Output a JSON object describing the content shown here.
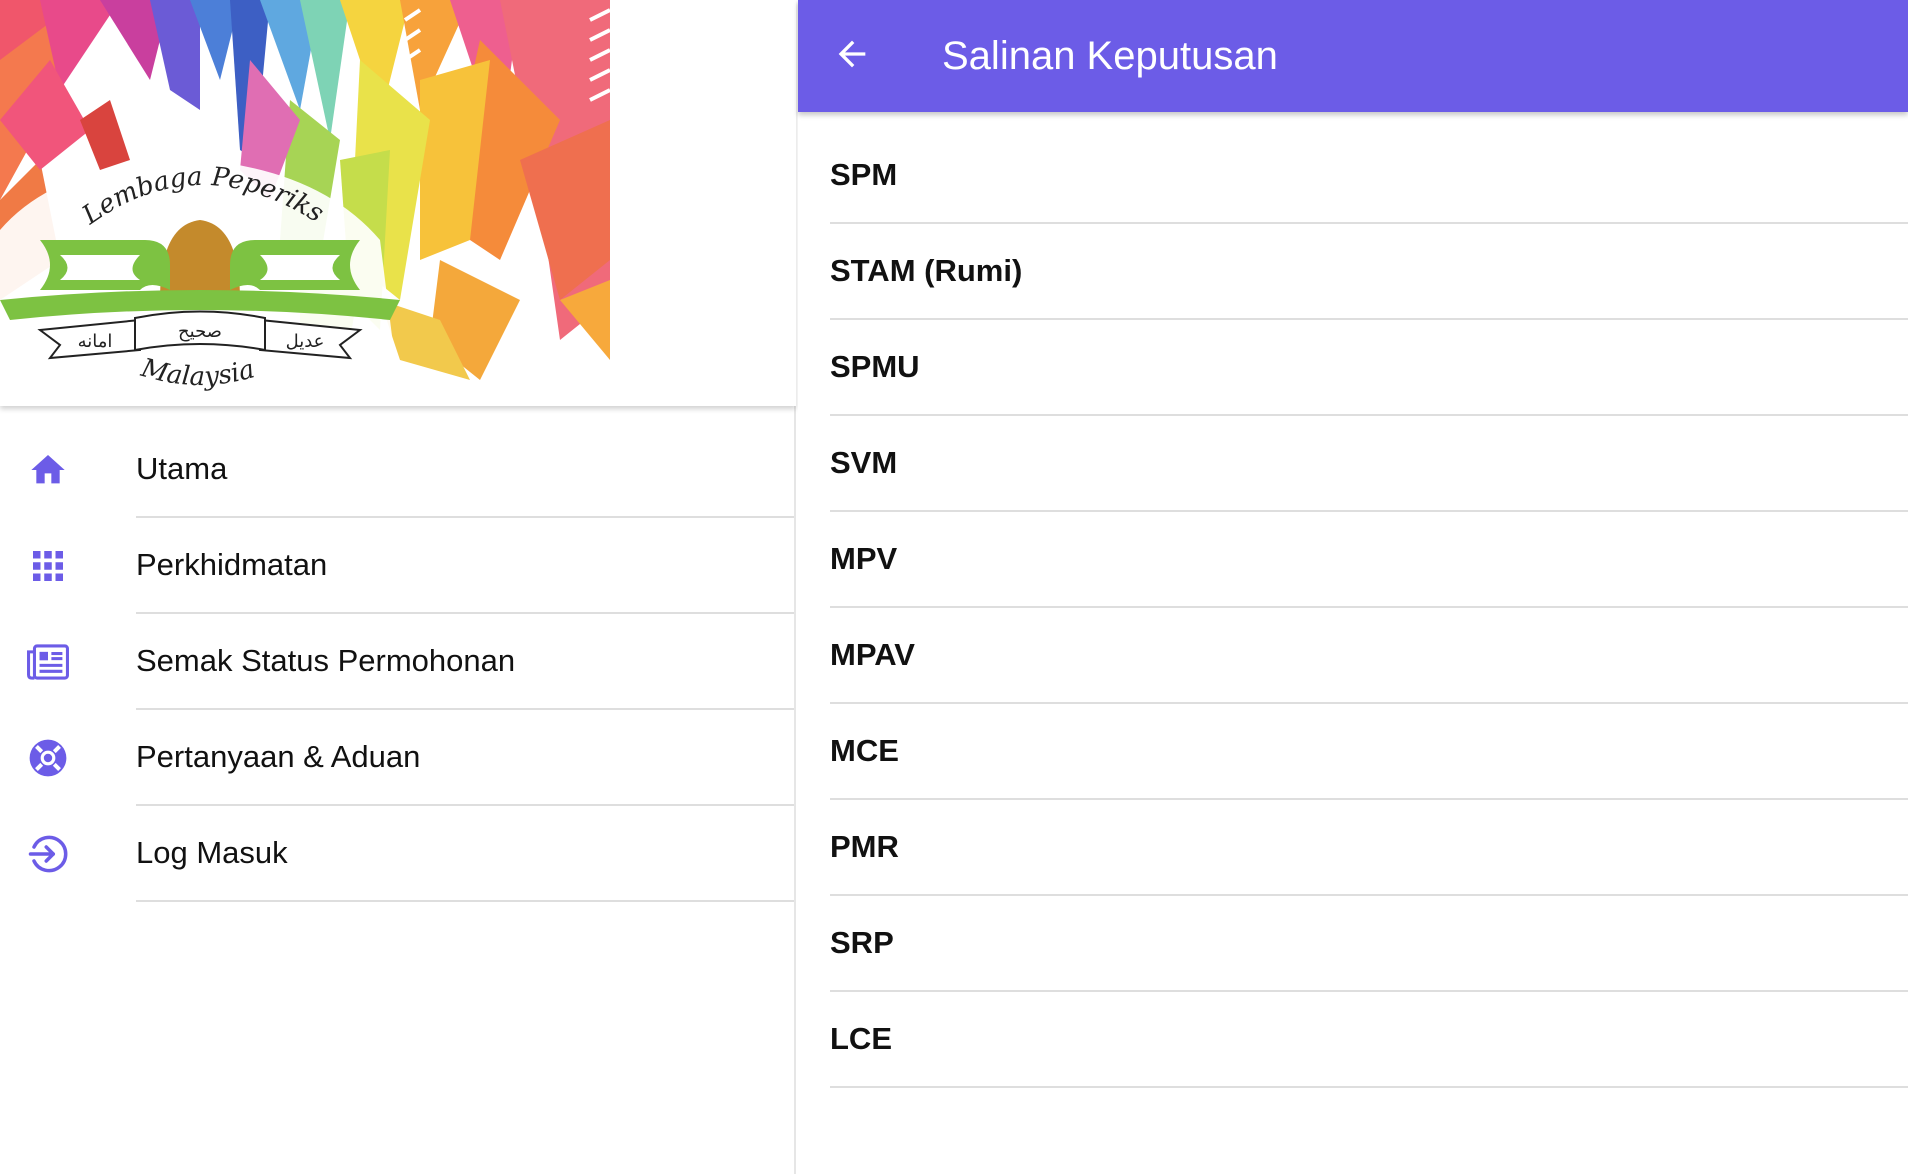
{
  "drawer": {
    "logo": {
      "arc_text": "Lembaga Peperiksaan",
      "bottom_text": "Malaysia",
      "ribbon_left": "امانه",
      "ribbon_center": "صحيح",
      "ribbon_right": "عديل"
    },
    "items": [
      {
        "label": "Utama",
        "icon": "home-icon"
      },
      {
        "label": "Perkhidmatan",
        "icon": "apps-grid-icon"
      },
      {
        "label": "Semak Status Permohonan",
        "icon": "newspaper-icon"
      },
      {
        "label": "Pertanyaan & Aduan",
        "icon": "lifebuoy-icon"
      },
      {
        "label": "Log Masuk",
        "icon": "login-icon"
      }
    ]
  },
  "appbar": {
    "title": "Salinan Keputusan",
    "back_icon": "arrow-back-icon"
  },
  "exams": [
    "SPM",
    "STAM (Rumi)",
    "SPMU",
    "SVM",
    "MPV",
    "MPAV",
    "MCE",
    "PMR",
    "SRP",
    "LCE"
  ],
  "colors": {
    "accent": "#6c5ce7",
    "icon": "#6c5ce7",
    "text": "#111111",
    "divider": "#dedede"
  }
}
